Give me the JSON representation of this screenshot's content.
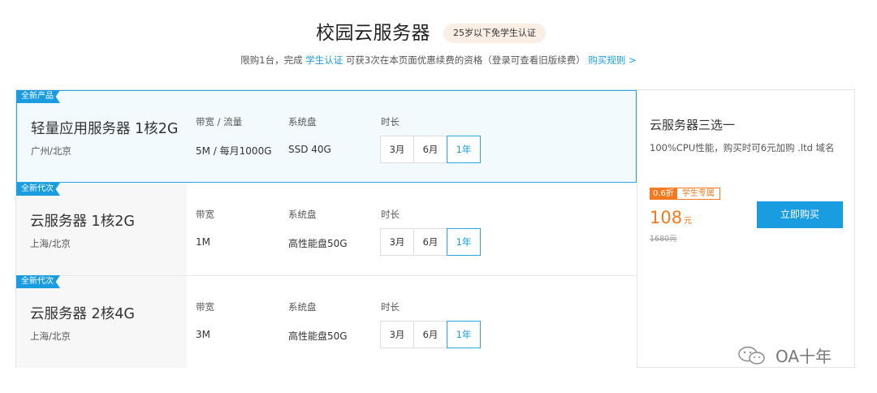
{
  "header": {
    "title": "校园云服务器",
    "badge": "25岁以下免学生认证",
    "subtitle_before": "限购1台，完成 ",
    "subtitle_link": "学生认证",
    "subtitle_middle": " 可获3次在本页面优惠续费的资格（登录可查看旧版续费）",
    "subtitle_rules_link": "购买规则 >"
  },
  "products": [
    {
      "tag": "全新产品",
      "name": "轻量应用服务器 1核2G",
      "region": "广州/北京",
      "bandwidth_label": "带宽 / 流量",
      "bandwidth_value": "5M / 每月1000G",
      "disk_label": "系统盘",
      "disk_value": "SSD 40G",
      "duration_label": "时长",
      "durations": [
        "3月",
        "6月",
        "1年"
      ],
      "selected_duration": "1年",
      "selected": true
    },
    {
      "tag": "全新代次",
      "name": "云服务器 1核2G",
      "region": "上海/北京",
      "bandwidth_label": "带宽",
      "bandwidth_value": "1M",
      "disk_label": "系统盘",
      "disk_value": "高性能盘50G",
      "duration_label": "时长",
      "durations": [
        "3月",
        "6月",
        "1年"
      ],
      "selected_duration": "1年",
      "selected": false
    },
    {
      "tag": "全新代次",
      "name": "云服务器 2核4G",
      "region": "上海/北京",
      "bandwidth_label": "带宽",
      "bandwidth_value": "3M",
      "disk_label": "系统盘",
      "disk_value": "高性能盘50G",
      "duration_label": "时长",
      "durations": [
        "3月",
        "6月",
        "1年"
      ],
      "selected_duration": "1年",
      "selected": false
    }
  ],
  "side": {
    "title": "云服务器三选一",
    "description": "100%CPU性能，购买时可6元加购 .ltd 域名",
    "discount": "0.6折",
    "discount_label": "学生专属",
    "price": "108",
    "price_unit": "元",
    "original_price": "1680元",
    "buy_button": "立即购买"
  },
  "watermark": {
    "text": "OA十年",
    "icon": "wechat-icon"
  },
  "colors": {
    "accent": "#1a9de0",
    "orange": "#f47a1f",
    "badge_bg": "#fbeee4"
  }
}
